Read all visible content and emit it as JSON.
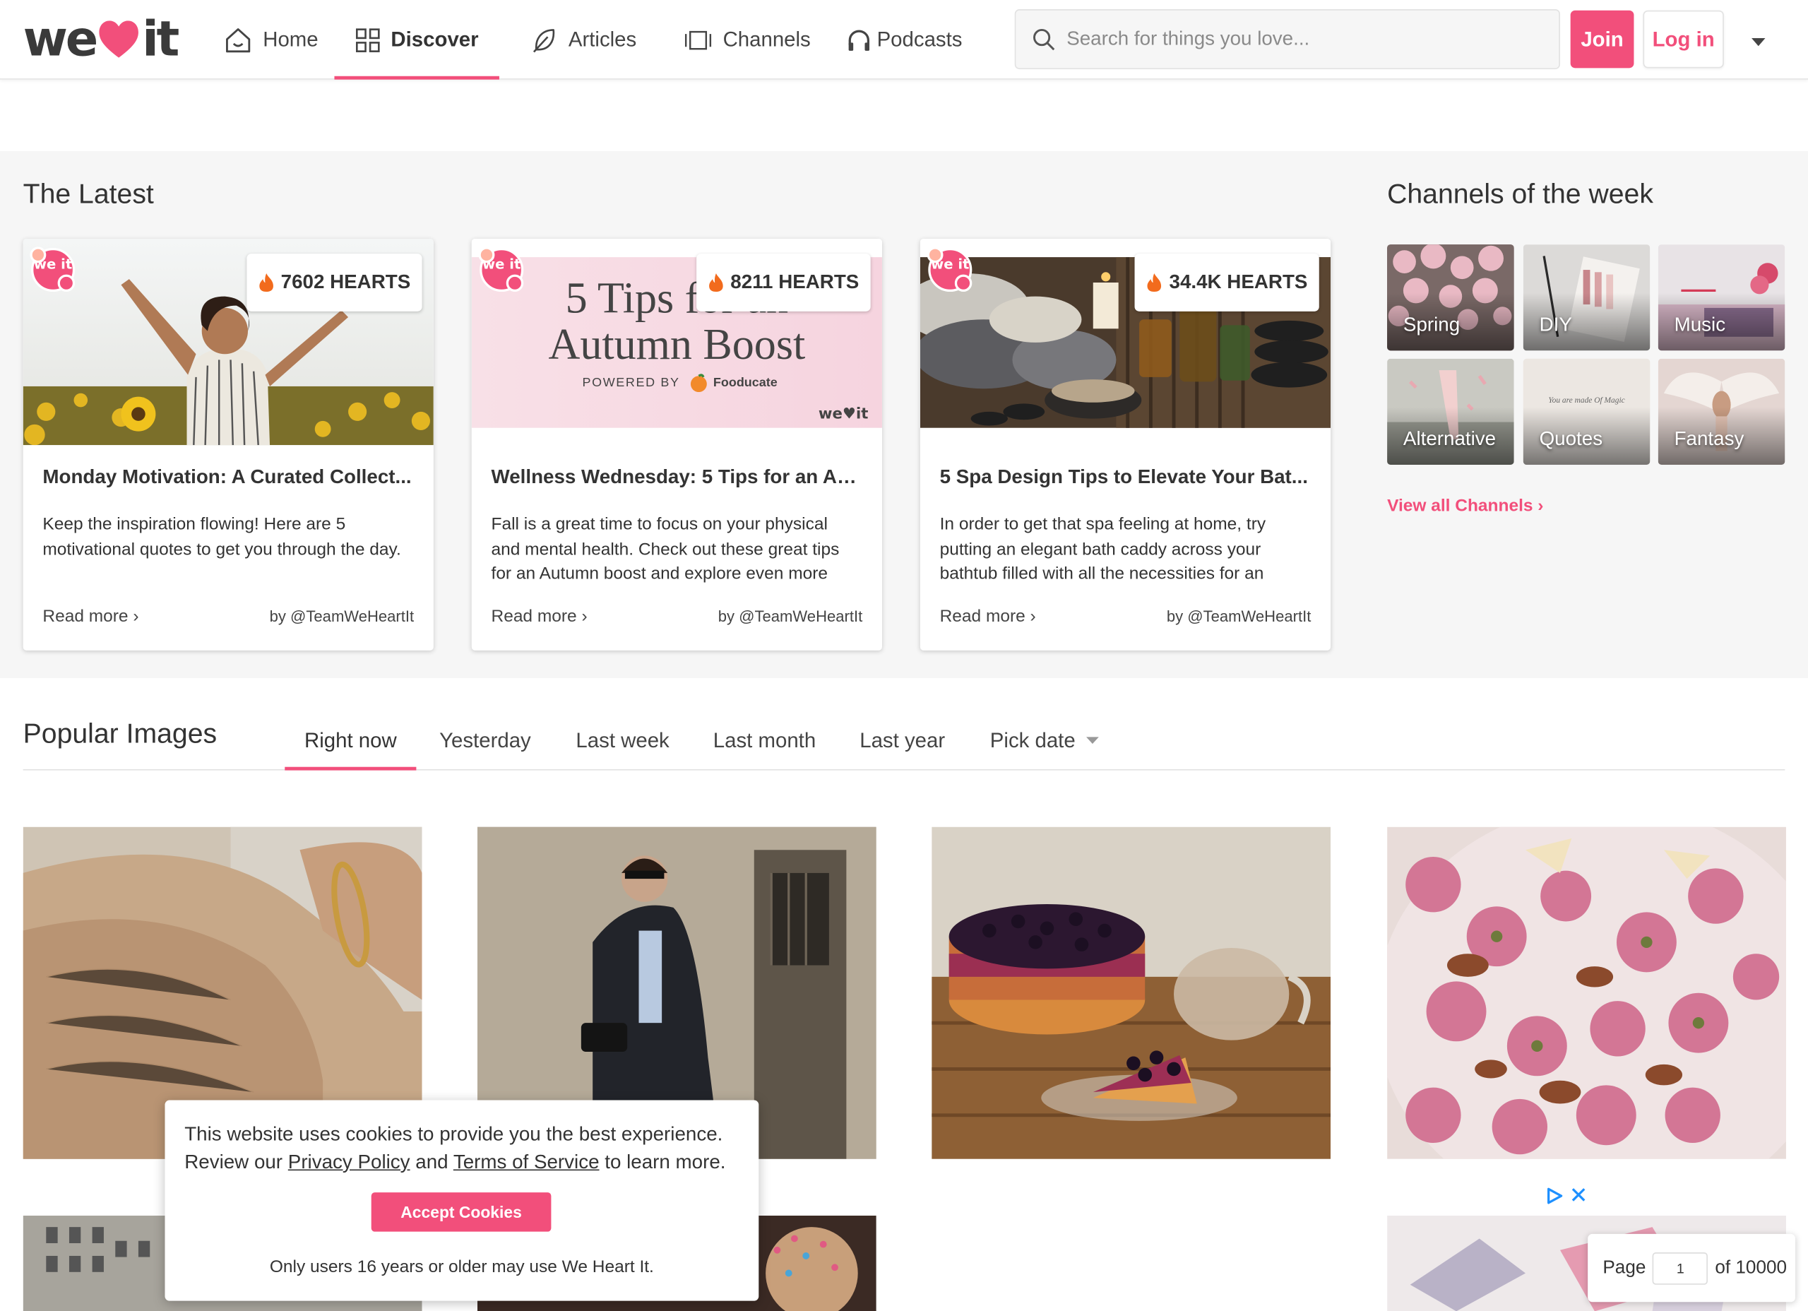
{
  "brand": {
    "logo_text_left": "we",
    "logo_text_right": "it",
    "accent": "#f24f7b"
  },
  "nav": {
    "items": [
      {
        "label": "Home",
        "icon": "house-icon",
        "active": false
      },
      {
        "label": "Discover",
        "icon": "grid-icon",
        "active": true
      },
      {
        "label": "Articles",
        "icon": "feather-icon",
        "active": false
      },
      {
        "label": "Channels",
        "icon": "channels-icon",
        "active": false
      },
      {
        "label": "Podcasts",
        "icon": "headphones-icon",
        "active": false
      }
    ]
  },
  "search": {
    "placeholder": "Search for things you love...",
    "value": ""
  },
  "auth": {
    "join_label": "Join",
    "login_label": "Log in"
  },
  "latest": {
    "title": "The Latest",
    "cards": [
      {
        "hearts": "7602 HEARTS",
        "title": "Monday Motivation: A Curated Collect...",
        "description": "Keep the inspiration flowing! Here are 5 motivational quotes to get you through the day.",
        "read_more": "Read more ›",
        "author": "by @TeamWeHeartIt",
        "badge": "we it"
      },
      {
        "hearts": "8211 HEARTS",
        "title": "Wellness Wednesday: 5 Tips for an Au...",
        "description": "Fall is a great time to focus on your physical and mental health. Check out these great tips for an Autumn boost and explore even more",
        "read_more": "Read more ›",
        "author": "by @TeamWeHeartIt",
        "badge": "we it",
        "image_text": {
          "line1": "5 Tips for an",
          "line2": "Autumn Boost",
          "powered": "POWERED BY",
          "partner": "Fooducate",
          "watermark": "we♥it"
        }
      },
      {
        "hearts": "34.4K HEARTS",
        "title": "5 Spa Design Tips to Elevate Your Bat...",
        "description": "In order to get that spa feeling at home, try putting an elegant bath caddy across your bathtub filled with all the necessities for an",
        "read_more": "Read more ›",
        "author": "by @TeamWeHeartIt",
        "badge": "we it"
      }
    ]
  },
  "channels": {
    "title": "Channels of the week",
    "items": [
      {
        "label": "Spring"
      },
      {
        "label": "DIY"
      },
      {
        "label": "Music"
      },
      {
        "label": "Alternative"
      },
      {
        "label": "Quotes",
        "image_text": "You are made Of Magic"
      },
      {
        "label": "Fantasy"
      }
    ],
    "view_all": "View all Channels ›"
  },
  "popular": {
    "title": "Popular Images",
    "tabs": [
      {
        "label": "Right now",
        "active": true
      },
      {
        "label": "Yesterday",
        "active": false
      },
      {
        "label": "Last week",
        "active": false
      },
      {
        "label": "Last month",
        "active": false
      },
      {
        "label": "Last year",
        "active": false
      },
      {
        "label": "Pick date",
        "active": false
      }
    ]
  },
  "cookie": {
    "line1": "This website uses cookies to provide you the best experience.",
    "review": "Review our",
    "privacy": "Privacy Policy",
    "and": "and",
    "terms": "Terms of Service",
    "learn": "to learn more.",
    "accept": "Accept Cookies",
    "age_notice": "Only users 16 years or older may use We Heart It."
  },
  "pager": {
    "label": "Page",
    "current": "1",
    "of_label": "of 10000"
  }
}
